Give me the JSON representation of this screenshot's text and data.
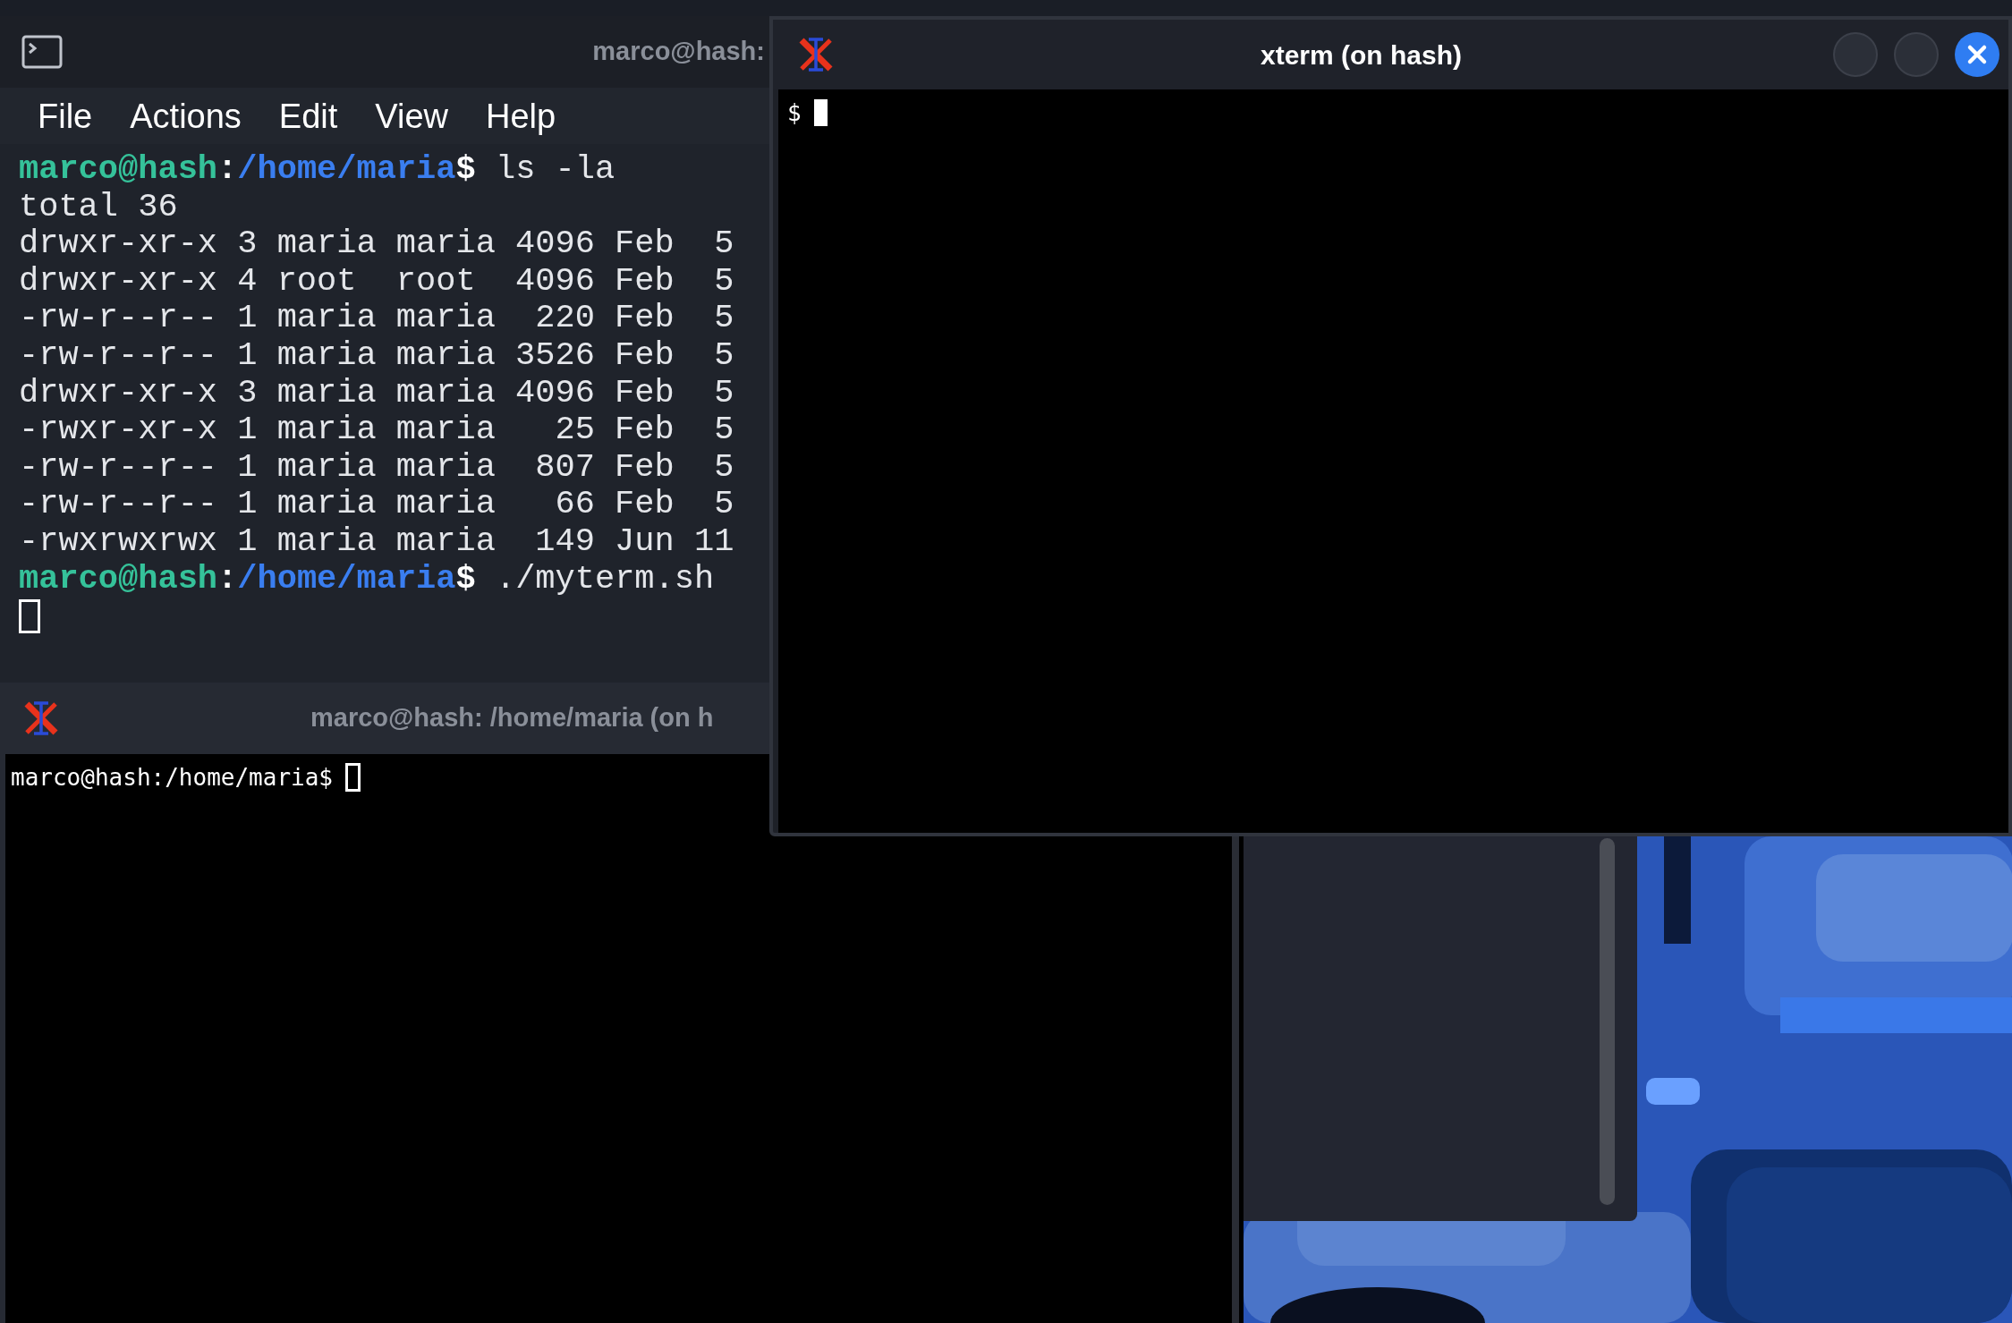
{
  "terminal_window": {
    "title": "marco@hash:",
    "menu": [
      "File",
      "Actions",
      "Edit",
      "View",
      "Help"
    ],
    "lines": [
      {
        "kind": "prompt",
        "user": "marco@hash",
        "separator": ":",
        "path": "/home/maria",
        "symbol": "$",
        "command": " ls -la"
      },
      {
        "kind": "output",
        "text": "total 36"
      },
      {
        "kind": "output",
        "text": "drwxr-xr-x 3 maria maria 4096 Feb  5"
      },
      {
        "kind": "output",
        "text": "drwxr-xr-x 4 root  root  4096 Feb  5"
      },
      {
        "kind": "output",
        "text": "-rw-r--r-- 1 maria maria  220 Feb  5"
      },
      {
        "kind": "output",
        "text": "-rw-r--r-- 1 maria maria 3526 Feb  5"
      },
      {
        "kind": "output",
        "text": "drwxr-xr-x 3 maria maria 4096 Feb  5"
      },
      {
        "kind": "output",
        "text": "-rwxr-xr-x 1 maria maria   25 Feb  5"
      },
      {
        "kind": "output",
        "text": "-rw-r--r-- 1 maria maria  807 Feb  5"
      },
      {
        "kind": "output",
        "text": "-rw-r--r-- 1 maria maria   66 Feb  5"
      },
      {
        "kind": "output",
        "text": "-rwxrwxrwx 1 maria maria  149 Jun 11"
      },
      {
        "kind": "prompt",
        "user": "marco@hash",
        "separator": ":",
        "path": "/home/maria",
        "symbol": "$",
        "command": " ./myterm.sh"
      }
    ],
    "cursor_focused": false
  },
  "xterm_back": {
    "title": "marco@hash: /home/maria (on h",
    "prompt": "marco@hash:/home/maria$",
    "cursor_focused": false
  },
  "xterm_front": {
    "title": "xterm (on hash)",
    "prompt": "$",
    "cursor_focused": true,
    "active": true
  }
}
